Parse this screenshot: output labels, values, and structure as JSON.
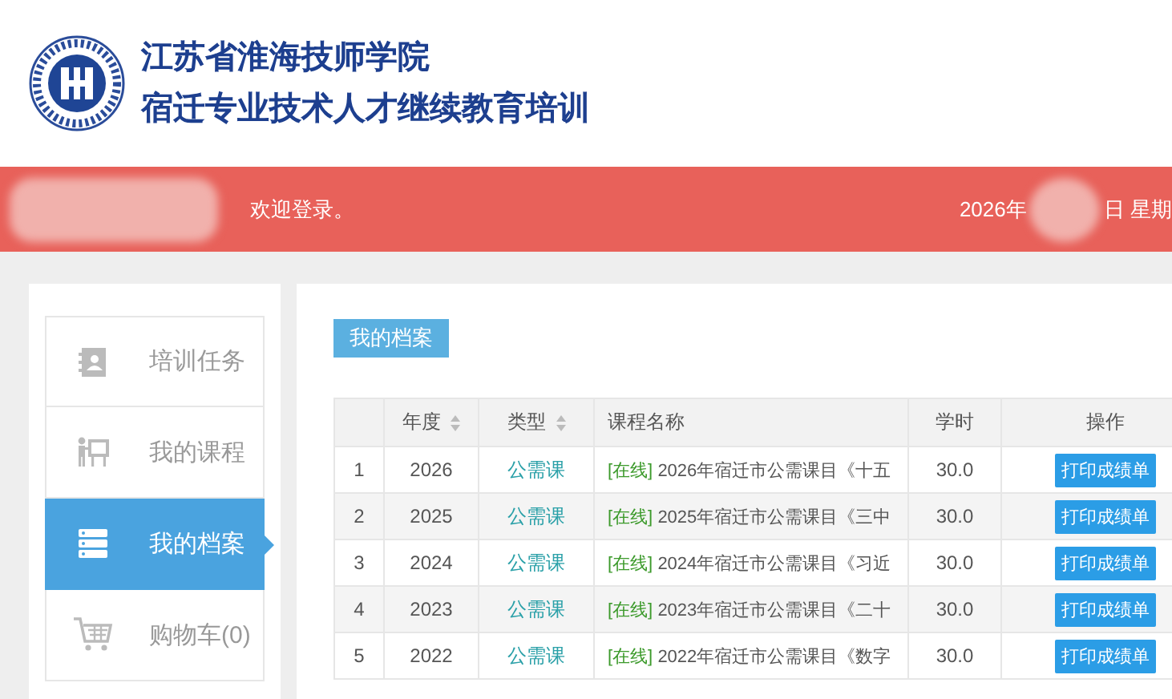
{
  "header": {
    "title": "江苏省淮海技师学院",
    "subtitle": "宿迁专业技术人才继续教育培训"
  },
  "top_bar": {
    "welcome": "欢迎登录。",
    "date_start": "2026年",
    "date_end": "日 星期"
  },
  "sidebar": {
    "items": [
      {
        "label": "培训任务",
        "kind": "task",
        "selected": false
      },
      {
        "label": "我的课程",
        "kind": "course",
        "selected": false
      },
      {
        "label": "我的档案",
        "kind": "archive",
        "selected": true
      },
      {
        "label": "购物车(0)",
        "kind": "cart",
        "selected": false
      }
    ]
  },
  "archive": {
    "tab": "我的档案",
    "columns": [
      {
        "label": "年度",
        "sortable": true
      },
      {
        "label": "类型",
        "sortable": true
      },
      {
        "label": "课程名称",
        "sortable": false
      },
      {
        "label": "学时",
        "sortable": false
      },
      {
        "label": "操作",
        "sortable": false
      }
    ],
    "rows": [
      {
        "index": "1",
        "year": "2026",
        "type": "公需课",
        "mode": "[在线]",
        "name": "2026年宿迁市公需课目《十五",
        "hours": "30.0",
        "action": "打印成绩单"
      },
      {
        "index": "2",
        "year": "2025",
        "type": "公需课",
        "mode": "[在线]",
        "name": "2025年宿迁市公需课目《三中",
        "hours": "30.0",
        "action": "打印成绩单"
      },
      {
        "index": "3",
        "year": "2024",
        "type": "公需课",
        "mode": "[在线]",
        "name": "2024年宿迁市公需课目《习近",
        "hours": "30.0",
        "action": "打印成绩单"
      },
      {
        "index": "4",
        "year": "2023",
        "type": "公需课",
        "mode": "[在线]",
        "name": "2023年宿迁市公需课目《二十",
        "hours": "30.0",
        "action": "打印成绩单"
      },
      {
        "index": "5",
        "year": "2022",
        "type": "公需课",
        "mode": "[在线]",
        "name": "2022年宿迁市公需课目《数字",
        "hours": "30.0",
        "action": "打印成绩单"
      }
    ]
  }
}
